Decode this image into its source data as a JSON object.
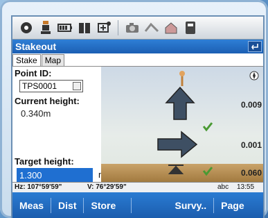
{
  "window": {
    "title": "Stakeout"
  },
  "toolbar": {
    "icons": [
      "satellite-icon",
      "rover-icon",
      "battery-icon",
      "bars-icon",
      "radio-icon",
      "camera-icon",
      "settings-icon",
      "home-icon",
      "sd-icon"
    ]
  },
  "tabs": [
    "Stake",
    "Map"
  ],
  "fields": {
    "point_id_label": "Point ID:",
    "point_id_value": "TPS0001",
    "current_height_label": "Current height:",
    "current_height_value": "0.340m",
    "target_height_label": "Target height:",
    "target_height_value": "1.300",
    "target_height_unit": "m"
  },
  "graphic": {
    "up_value": "0.009",
    "right_value": "0.001",
    "cut_value": "0.060"
  },
  "status": {
    "hz": "Hz: 107°59'59\"",
    "v": "V: 76°29'59\"",
    "mode": "abc",
    "time": "13:55"
  },
  "softkeys": [
    "Meas",
    "Dist",
    "Store",
    "Survy..",
    "Page"
  ],
  "colors": {
    "accent": "#1f6fd1",
    "titlebar": "#2e7fd6"
  }
}
